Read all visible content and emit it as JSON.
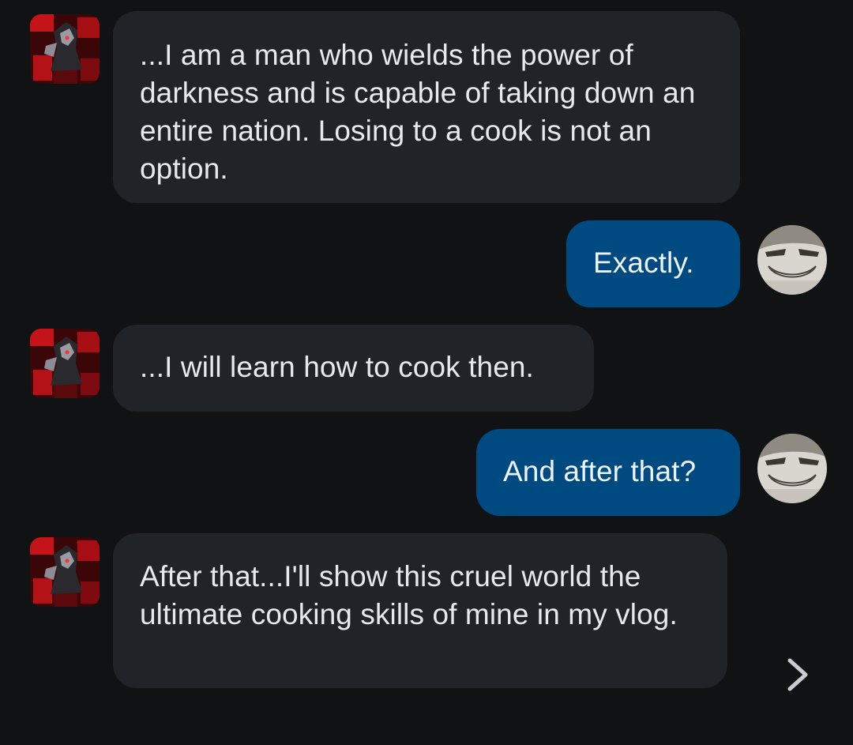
{
  "conversation": {
    "messages": [
      {
        "sender": "bot",
        "avatar_icon": "dark-knight-avatar",
        "text": "...I am a man who wields the power of darkness and is capable of taking down an entire nation. Losing to a cook is not an option."
      },
      {
        "sender": "user",
        "avatar_icon": "grinning-face-avatar",
        "text": "Exactly."
      },
      {
        "sender": "bot",
        "avatar_icon": "dark-knight-avatar",
        "text": "...I will learn how to cook then."
      },
      {
        "sender": "user",
        "avatar_icon": "grinning-face-avatar",
        "text": "And after that?"
      },
      {
        "sender": "bot",
        "avatar_icon": "dark-knight-avatar",
        "text": "After that...I'll show this cruel world the ultimate cooking skills of mine in my vlog."
      }
    ]
  },
  "controls": {
    "next_icon": "chevron-right-icon"
  },
  "colors": {
    "background": "#111214",
    "bot_bubble": "#202327",
    "user_bubble": "#004a82",
    "text": "#e6e9ee",
    "chevron": "#c9ccd1"
  }
}
